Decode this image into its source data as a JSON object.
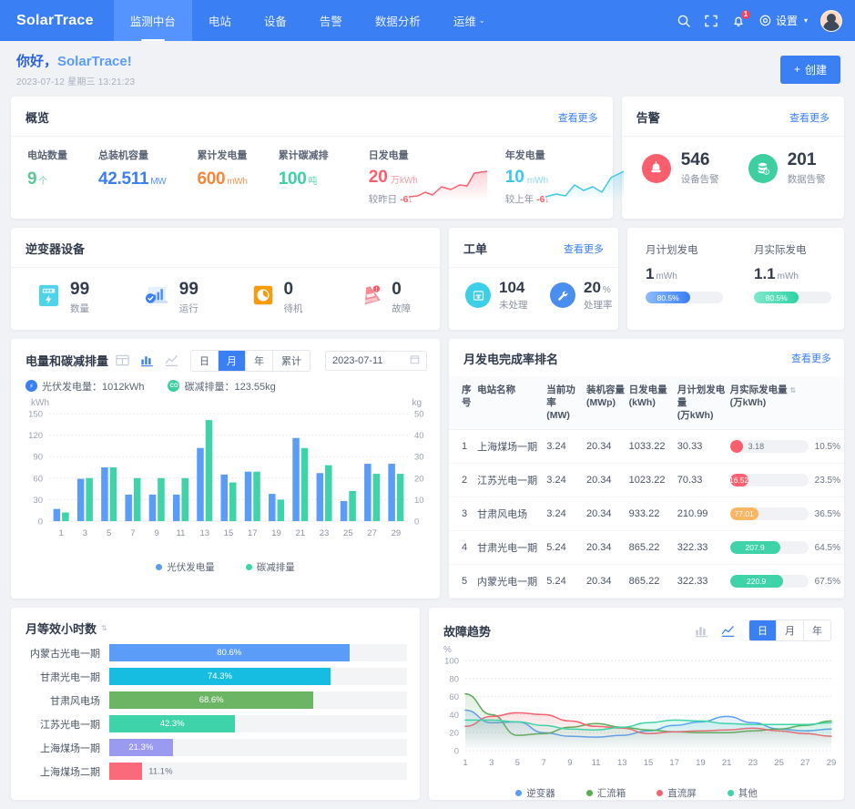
{
  "brand": "SolarTrace",
  "nav": {
    "items": [
      {
        "label": "监测中台",
        "active": true
      },
      {
        "label": "电站",
        "active": false
      },
      {
        "label": "设备",
        "active": false
      },
      {
        "label": "告警",
        "active": false
      },
      {
        "label": "数据分析",
        "active": false
      },
      {
        "label": "运维",
        "active": false,
        "caret": "⌄"
      }
    ],
    "settings_label": "设置",
    "notification_badge": "1"
  },
  "greeting": {
    "hello": "你好，",
    "name": "SolarTrace!",
    "date": "2023-07-12 星期三 13:21:23",
    "create_label": "创建",
    "create_plus": "+"
  },
  "overview": {
    "title": "概览",
    "more": "查看更多",
    "stats": [
      {
        "label": "电站数量",
        "value": "9",
        "unit": "个",
        "color": "#5bc89a"
      },
      {
        "label": "总装机容量",
        "value": "42.511",
        "unit": "MW",
        "color": "#3b7ff5"
      },
      {
        "label": "累计发电量",
        "value": "600",
        "unit": "mWh",
        "color": "#f5863a"
      },
      {
        "label": "累计碳减排",
        "value": "100",
        "unit": "吨",
        "color": "#3cd0a5"
      }
    ],
    "trends": [
      {
        "label": "日发电量",
        "value": "20",
        "unit": "万kWh",
        "sub": "较昨日",
        "delta": "-6",
        "arrow": "↓",
        "color": "#fb5f6d"
      },
      {
        "label": "年发电量",
        "value": "10",
        "unit": "mWh",
        "sub": "较上年",
        "delta": "-6",
        "arrow": "↓",
        "color": "#3ec8e8"
      }
    ]
  },
  "alarm": {
    "title": "告警",
    "more": "查看更多",
    "items": [
      {
        "value": "546",
        "caption": "设备告警",
        "color": "#fb5f6d",
        "icon": "alarm-light-icon"
      },
      {
        "value": "201",
        "caption": "数据告警",
        "color": "#3ecfa0",
        "icon": "database-alert-icon"
      }
    ]
  },
  "inverter": {
    "title": "逆变器设备",
    "items": [
      {
        "value": "99",
        "caption": "数量",
        "icon": "inverter-box-icon"
      },
      {
        "value": "99",
        "caption": "运行",
        "icon": "running-chart-icon"
      },
      {
        "value": "0",
        "caption": "待机",
        "icon": "standby-clock-icon"
      },
      {
        "value": "0",
        "caption": "故障",
        "icon": "fault-cone-icon"
      }
    ]
  },
  "workorder": {
    "title": "工单",
    "more": "查看更多",
    "items": [
      {
        "value": "104",
        "suffix": "",
        "caption": "未处理",
        "color": "#3ccfe8",
        "icon": "ticket-icon"
      },
      {
        "value": "20",
        "suffix": "%",
        "caption": "处理率",
        "color": "#4a8ef0",
        "icon": "wrench-icon"
      }
    ]
  },
  "monthly_plan": {
    "items": [
      {
        "label": "月计划发电",
        "value": "1",
        "unit": "mWh",
        "pct_label": "80.5%",
        "pct": 80.5,
        "color_from": "#7bb3ff",
        "color_to": "#3b7ff5"
      },
      {
        "label": "月实际发电",
        "value": "1.1",
        "unit": "mWh",
        "pct_label": "80.5%",
        "pct": 80.5,
        "color_from": "#6fe3c4",
        "color_to": "#2fd1a5"
      }
    ]
  },
  "energy_card": {
    "title": "电量和碳减排量",
    "icons": [
      "table-view-icon",
      "bar-chart-icon",
      "line-chart-icon"
    ],
    "active_icon": "bar-chart-icon",
    "ranges": [
      "日",
      "月",
      "年",
      "累计"
    ],
    "active_range": "月",
    "date_value": "2023-07-11",
    "summary": [
      {
        "label": "光伏发电量：",
        "value": "1012kWh",
        "badge": "⚡",
        "color": "#3b7ff5"
      },
      {
        "label": "碳减排量：",
        "value": "123.55kg",
        "badge": "CO",
        "color": "#3ecfa0"
      }
    ],
    "left_unit": "kWh",
    "right_unit": "kg"
  },
  "chart_data": [
    {
      "type": "bar",
      "title": "电量和碳减排量",
      "xlabel": "",
      "ylabel": "kWh",
      "y2label": "kg",
      "ylim": [
        0,
        150
      ],
      "y2lim": [
        0,
        50
      ],
      "yticks": [
        0,
        30,
        60,
        90,
        120,
        150
      ],
      "y2ticks": [
        0,
        10,
        20,
        30,
        40,
        50
      ],
      "grid": true,
      "legend_position": "bottom",
      "x": [
        1,
        2,
        3,
        4,
        5,
        6,
        7,
        8,
        9,
        10,
        11,
        12,
        13,
        14,
        15
      ],
      "tick_labels": [
        "1",
        "3",
        "5",
        "7",
        "9",
        "11",
        "13",
        "15",
        "17",
        "19",
        "21",
        "23",
        "25",
        "27",
        "29"
      ],
      "series": [
        {
          "name": "光伏发电量",
          "color": "#5b9cf8",
          "axis": "left",
          "values": [
            17,
            59,
            75,
            37,
            37,
            37,
            102,
            65,
            69,
            38,
            116,
            67,
            28,
            80,
            80
          ]
        },
        {
          "name": "碳减排量",
          "color": "#3ed3a8",
          "axis": "right",
          "values": [
            4,
            20,
            25,
            20,
            20,
            20,
            47,
            18,
            23,
            10,
            34,
            26,
            14,
            22,
            22
          ]
        }
      ]
    },
    {
      "type": "bar",
      "orientation": "horizontal",
      "title": "月等效小时数",
      "categories": [
        "内蒙古光电一期",
        "甘肃光电一期",
        "甘肃风电场",
        "江苏光电一期",
        "上海煤场一期",
        "上海煤场二期"
      ],
      "values": [
        80.6,
        74.3,
        68.6,
        42.3,
        21.3,
        11.1
      ],
      "value_labels": [
        "80.6%",
        "74.3%",
        "68.6%",
        "42.3%",
        "21.3%",
        "11.1%"
      ],
      "colors": [
        "#5b9cf8",
        "#17bde0",
        "#6cb565",
        "#3ed3a8",
        "#9a9bf0",
        "#fb6a7b"
      ],
      "xlim": [
        0,
        100
      ],
      "grid": false,
      "legend_position": "none"
    },
    {
      "type": "line",
      "title": "故障趋势",
      "ylabel": "%",
      "ylim": [
        0,
        100
      ],
      "yticks": [
        0,
        20,
        40,
        60,
        80,
        100
      ],
      "grid": true,
      "legend_position": "bottom",
      "tick_labels": [
        "1",
        "3",
        "5",
        "7",
        "9",
        "11",
        "13",
        "15",
        "17",
        "19",
        "21",
        "23",
        "25",
        "27",
        "29"
      ],
      "x": [
        1,
        3,
        5,
        7,
        9,
        11,
        13,
        15,
        17,
        19,
        21,
        23,
        25,
        27,
        29
      ],
      "series": [
        {
          "name": "逆变器",
          "color": "#5b9cf8",
          "values": [
            45,
            31,
            32,
            20,
            16,
            15,
            17,
            22,
            28,
            32,
            38,
            31,
            24,
            22,
            24
          ]
        },
        {
          "name": "汇流箱",
          "color": "#5cab55",
          "values": [
            63,
            40,
            17,
            19,
            26,
            30,
            26,
            23,
            21,
            20,
            20,
            22,
            24,
            28,
            33
          ]
        },
        {
          "name": "直流屏",
          "color": "#f4616f",
          "values": [
            27,
            38,
            42,
            40,
            33,
            27,
            25,
            19,
            21,
            22,
            23,
            25,
            22,
            19,
            16
          ]
        },
        {
          "name": "其他",
          "color": "#3ed3a8",
          "values": [
            34,
            34,
            32,
            28,
            24,
            23,
            26,
            31,
            34,
            33,
            30,
            29,
            29,
            29,
            31
          ]
        }
      ]
    }
  ],
  "rank_card": {
    "title": "月发电完成率排名",
    "more": "查看更多",
    "columns": [
      {
        "l1": "序号",
        "l2": ""
      },
      {
        "l1": "电站名称",
        "l2": ""
      },
      {
        "l1": "当前功率",
        "l2": "(MW)"
      },
      {
        "l1": "装机容量",
        "l2": "(MWp)"
      },
      {
        "l1": "日发电量",
        "l2": "(kWh)"
      },
      {
        "l1": "月计划发电量",
        "l2": "(万kWh)"
      },
      {
        "l1": "月实际发电量",
        "l2": "(万kWh)",
        "sortable": true
      }
    ],
    "rows": [
      {
        "no": "1",
        "name": "上海煤场一期",
        "power": "3.24",
        "capacity": "20.34",
        "daily": "1033.22",
        "plan": "30.33",
        "actual": "3.18",
        "pct": "10.5%",
        "pct_num": 10.5,
        "color": "#fb5f6d"
      },
      {
        "no": "2",
        "name": "江苏光电一期",
        "power": "3.24",
        "capacity": "20.34",
        "daily": "1023.22",
        "plan": "70.33",
        "actual": "16.52",
        "pct": "23.5%",
        "pct_num": 23.5,
        "color": "#fb6273"
      },
      {
        "no": "3",
        "name": "甘肃风电场",
        "power": "3.24",
        "capacity": "20.34",
        "daily": "933.22",
        "plan": "210.99",
        "actual": "77.01",
        "pct": "36.5%",
        "pct_num": 36.5,
        "color": "#fcb663"
      },
      {
        "no": "4",
        "name": "甘肃光电一期",
        "power": "5.24",
        "capacity": "20.34",
        "daily": "865.22",
        "plan": "322.33",
        "actual": "207.9",
        "pct": "64.5%",
        "pct_num": 64.5,
        "color": "#3ed3a8"
      },
      {
        "no": "5",
        "name": "内蒙光电一期",
        "power": "5.24",
        "capacity": "20.34",
        "daily": "865.22",
        "plan": "322.33",
        "actual": "220.9",
        "pct": "67.5%",
        "pct_num": 67.5,
        "color": "#3ed3a8"
      }
    ]
  },
  "hours_card": {
    "title": "月等效小时数",
    "sort_icon": "sort-icon"
  },
  "fault_card": {
    "title": "故障趋势",
    "icons": [
      "bar-chart-icon",
      "line-chart-icon"
    ],
    "active_icon": "line-chart-icon",
    "ranges": [
      "日",
      "月",
      "年"
    ],
    "active_range": "日",
    "ylabel": "%"
  }
}
